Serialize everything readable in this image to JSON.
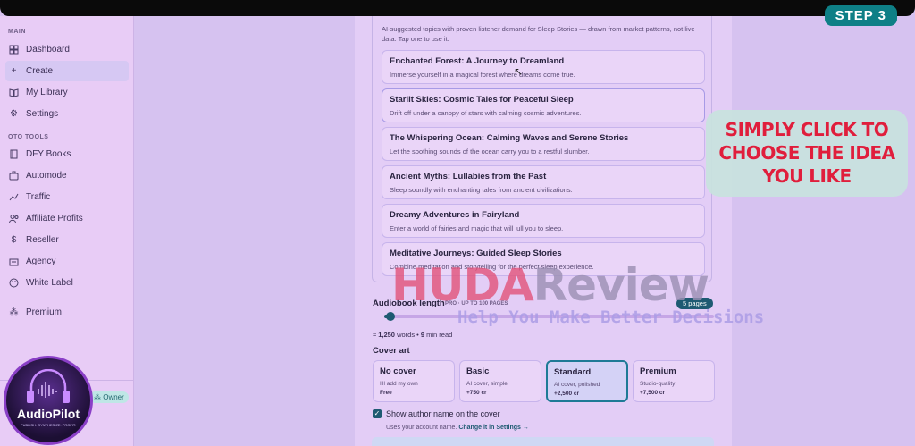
{
  "step_badge": "STEP 3",
  "sidebar": {
    "main_section": "MAIN",
    "tools_section": "OTO TOOLS",
    "items": [
      {
        "label": "Dashboard",
        "icon": "grid-icon"
      },
      {
        "label": "Create",
        "icon": "plus-icon",
        "active": true
      },
      {
        "label": "My Library",
        "icon": "book-icon"
      },
      {
        "label": "Settings",
        "icon": "gear-icon"
      }
    ],
    "tools": [
      {
        "label": "DFY Books",
        "icon": "book-icon"
      },
      {
        "label": "Automode",
        "icon": "automode-icon"
      },
      {
        "label": "Traffic",
        "icon": "traffic-icon"
      },
      {
        "label": "Affiliate Profits",
        "icon": "users-icon"
      },
      {
        "label": "Reseller",
        "icon": "dollar-icon"
      },
      {
        "label": "Agency",
        "icon": "briefcase-icon"
      },
      {
        "label": "White Label",
        "icon": "palette-icon"
      }
    ],
    "premium": "Premium",
    "owner_badge": "Owner"
  },
  "logo": {
    "name": "AudioPilot",
    "tagline": "PUBLISH. SYNTHESIZE. PROFIT."
  },
  "ideas": {
    "note": "AI-suggested topics with proven listener demand for Sleep Stories — drawn from market patterns, not live data. Tap one to use it.",
    "items": [
      {
        "title": "Enchanted Forest: A Journey to Dreamland",
        "desc": "Immerse yourself in a magical forest where dreams come true."
      },
      {
        "title": "Starlit Skies: Cosmic Tales for Peaceful Sleep",
        "desc": "Drift off under a canopy of stars with calming cosmic adventures."
      },
      {
        "title": "The Whispering Ocean: Calming Waves and Serene Stories",
        "desc": "Let the soothing sounds of the ocean carry you to a restful slumber."
      },
      {
        "title": "Ancient Myths: Lullabies from the Past",
        "desc": "Sleep soundly with enchanting tales from ancient civilizations."
      },
      {
        "title": "Dreamy Adventures in Fairyland",
        "desc": "Enter a world of fairies and magic that will lull you to sleep."
      },
      {
        "title": "Meditative Journeys: Guided Sleep Stories",
        "desc": "Combine meditation and storytelling for the perfect sleep experience."
      }
    ]
  },
  "length": {
    "label": "Audiobook length",
    "sublabel": "PRO · UP TO 100 PAGES",
    "pages_badge": "5 pages",
    "slider_fraction": 0.02,
    "words_prefix": "≈ ",
    "words": "1,250",
    "words_unit": " words • ",
    "minutes": "9",
    "minutes_unit": " min read"
  },
  "cover": {
    "label": "Cover art",
    "options": [
      {
        "name": "No cover",
        "sub": "I'll add my own",
        "price": "Free"
      },
      {
        "name": "Basic",
        "sub": "AI cover, simple",
        "price": "+750 cr"
      },
      {
        "name": "Standard",
        "sub": "AI cover, polished",
        "price": "+2,500 cr",
        "selected": true
      },
      {
        "name": "Premium",
        "sub": "Studio-quality",
        "price": "+7,500 cr"
      }
    ]
  },
  "author": {
    "label": "Show author name on the cover",
    "sub": "Uses your account name. ",
    "link": "Change it in Settings →"
  },
  "callout": "SIMPLY CLICK TO CHOOSE THE IDEA YOU LIKE",
  "watermark": {
    "part1": "HUDA",
    "part2": "Review",
    "sub": "Help You Make Better Decisions"
  },
  "colors": {
    "accent": "#1e5a72",
    "step": "#0e7f86",
    "callout_text": "#e01e3c"
  }
}
